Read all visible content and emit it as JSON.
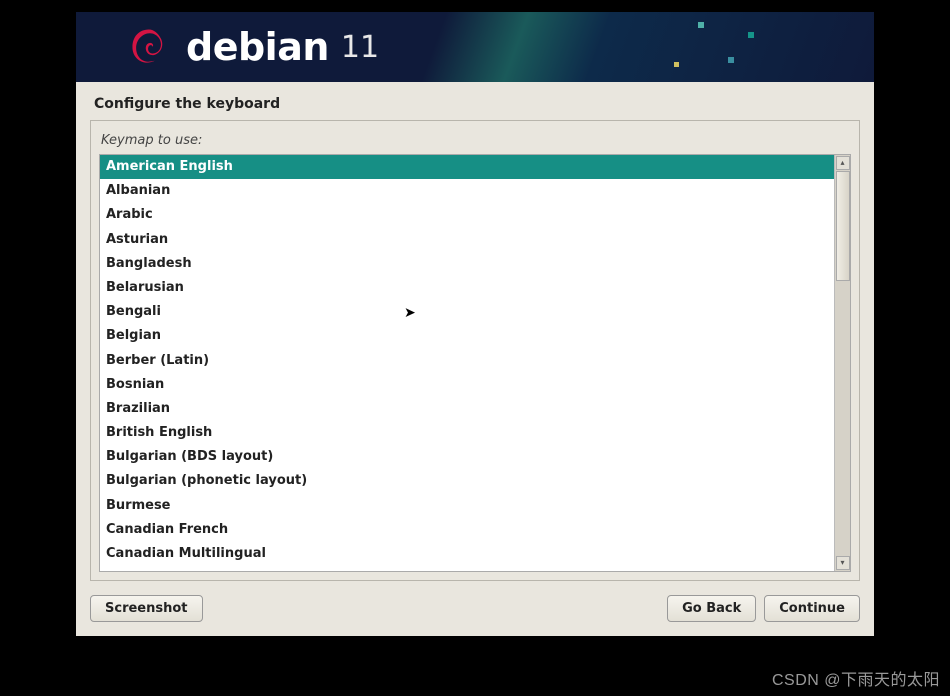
{
  "brand": {
    "name": "debian",
    "version": "11"
  },
  "page": {
    "title": "Configure the keyboard"
  },
  "field": {
    "label": "Keymap to use:"
  },
  "keymaps": {
    "selected_index": 0,
    "items": [
      "American English",
      "Albanian",
      "Arabic",
      "Asturian",
      "Bangladesh",
      "Belarusian",
      "Bengali",
      "Belgian",
      "Berber (Latin)",
      "Bosnian",
      "Brazilian",
      "British English",
      "Bulgarian (BDS layout)",
      "Bulgarian (phonetic layout)",
      "Burmese",
      "Canadian French",
      "Canadian Multilingual"
    ]
  },
  "buttons": {
    "screenshot": "Screenshot",
    "go_back": "Go Back",
    "continue": "Continue"
  },
  "watermark": "CSDN @下雨天的太阳"
}
